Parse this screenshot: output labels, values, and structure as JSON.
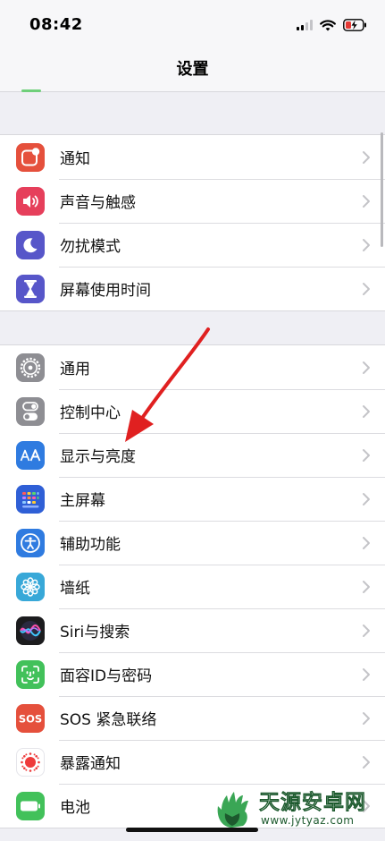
{
  "status": {
    "time": "08:42"
  },
  "nav": {
    "title": "设置"
  },
  "groups": [
    [
      {
        "label": "通知",
        "icon": "notifications-icon",
        "color": "#e5503c"
      },
      {
        "label": "声音与触感",
        "icon": "speaker-icon",
        "color": "#e63f5b"
      },
      {
        "label": "勿扰模式",
        "icon": "moon-icon",
        "color": "#5756c9"
      },
      {
        "label": "屏幕使用时间",
        "icon": "hourglass-icon",
        "color": "#5756c9"
      }
    ],
    [
      {
        "label": "通用",
        "icon": "gear-icon",
        "color": "#8e8e93"
      },
      {
        "label": "控制中心",
        "icon": "toggles-icon",
        "color": "#8e8e93"
      },
      {
        "label": "显示与亮度",
        "icon": "text-size-icon",
        "color": "#2f7be0"
      },
      {
        "label": "主屏幕",
        "icon": "home-screen-icon",
        "color": "#2f5fd6"
      },
      {
        "label": "辅助功能",
        "icon": "accessibility-icon",
        "color": "#2f7be0"
      },
      {
        "label": "墙纸",
        "icon": "flower-icon",
        "color": "#38a8d8"
      },
      {
        "label": "Siri与搜索",
        "icon": "siri-icon",
        "color": "#1c1c1e"
      },
      {
        "label": "面容ID与密码",
        "icon": "face-id-icon",
        "color": "#42c15a"
      },
      {
        "label": "SOS 紧急联络",
        "icon": "sos-icon",
        "color": "#e5503c"
      },
      {
        "label": "暴露通知",
        "icon": "exposure-icon",
        "color": "#ffffff"
      },
      {
        "label": "电池",
        "icon": "battery-setting-icon",
        "color": "#42c15a"
      }
    ]
  ],
  "watermark": {
    "title": "天源安卓网",
    "url": "www.jytyaz.com"
  }
}
